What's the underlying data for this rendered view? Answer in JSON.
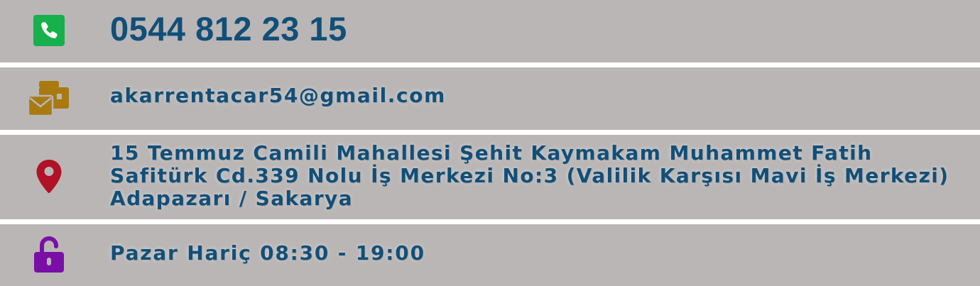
{
  "contact": {
    "phone": {
      "icon": "phone-icon",
      "icon_color": "#16b04c",
      "value": "0544 812 23 15"
    },
    "email": {
      "icon": "envelope-wallet-icon",
      "icon_color": "#a87a10",
      "value": "akarrentacar54@gmail.com"
    },
    "address": {
      "icon": "map-pin-icon",
      "icon_color": "#b01227",
      "value": "15 Temmuz Camili Mahallesi Şehit Kaymakam Muhammet Fatih Safitürk Cd.339 Nolu İş Merkezi No:3 (Valilik Karşısı Mavi İş Merkezi) Adapazarı / Sakarya"
    },
    "hours": {
      "icon": "unlock-icon",
      "icon_color": "#7a0fa8",
      "value": "Pazar Hariç 08:30 - 19:00"
    }
  },
  "colors": {
    "row_background": "#bab6b6",
    "text": "#124f78",
    "separator": "#ffffff"
  }
}
